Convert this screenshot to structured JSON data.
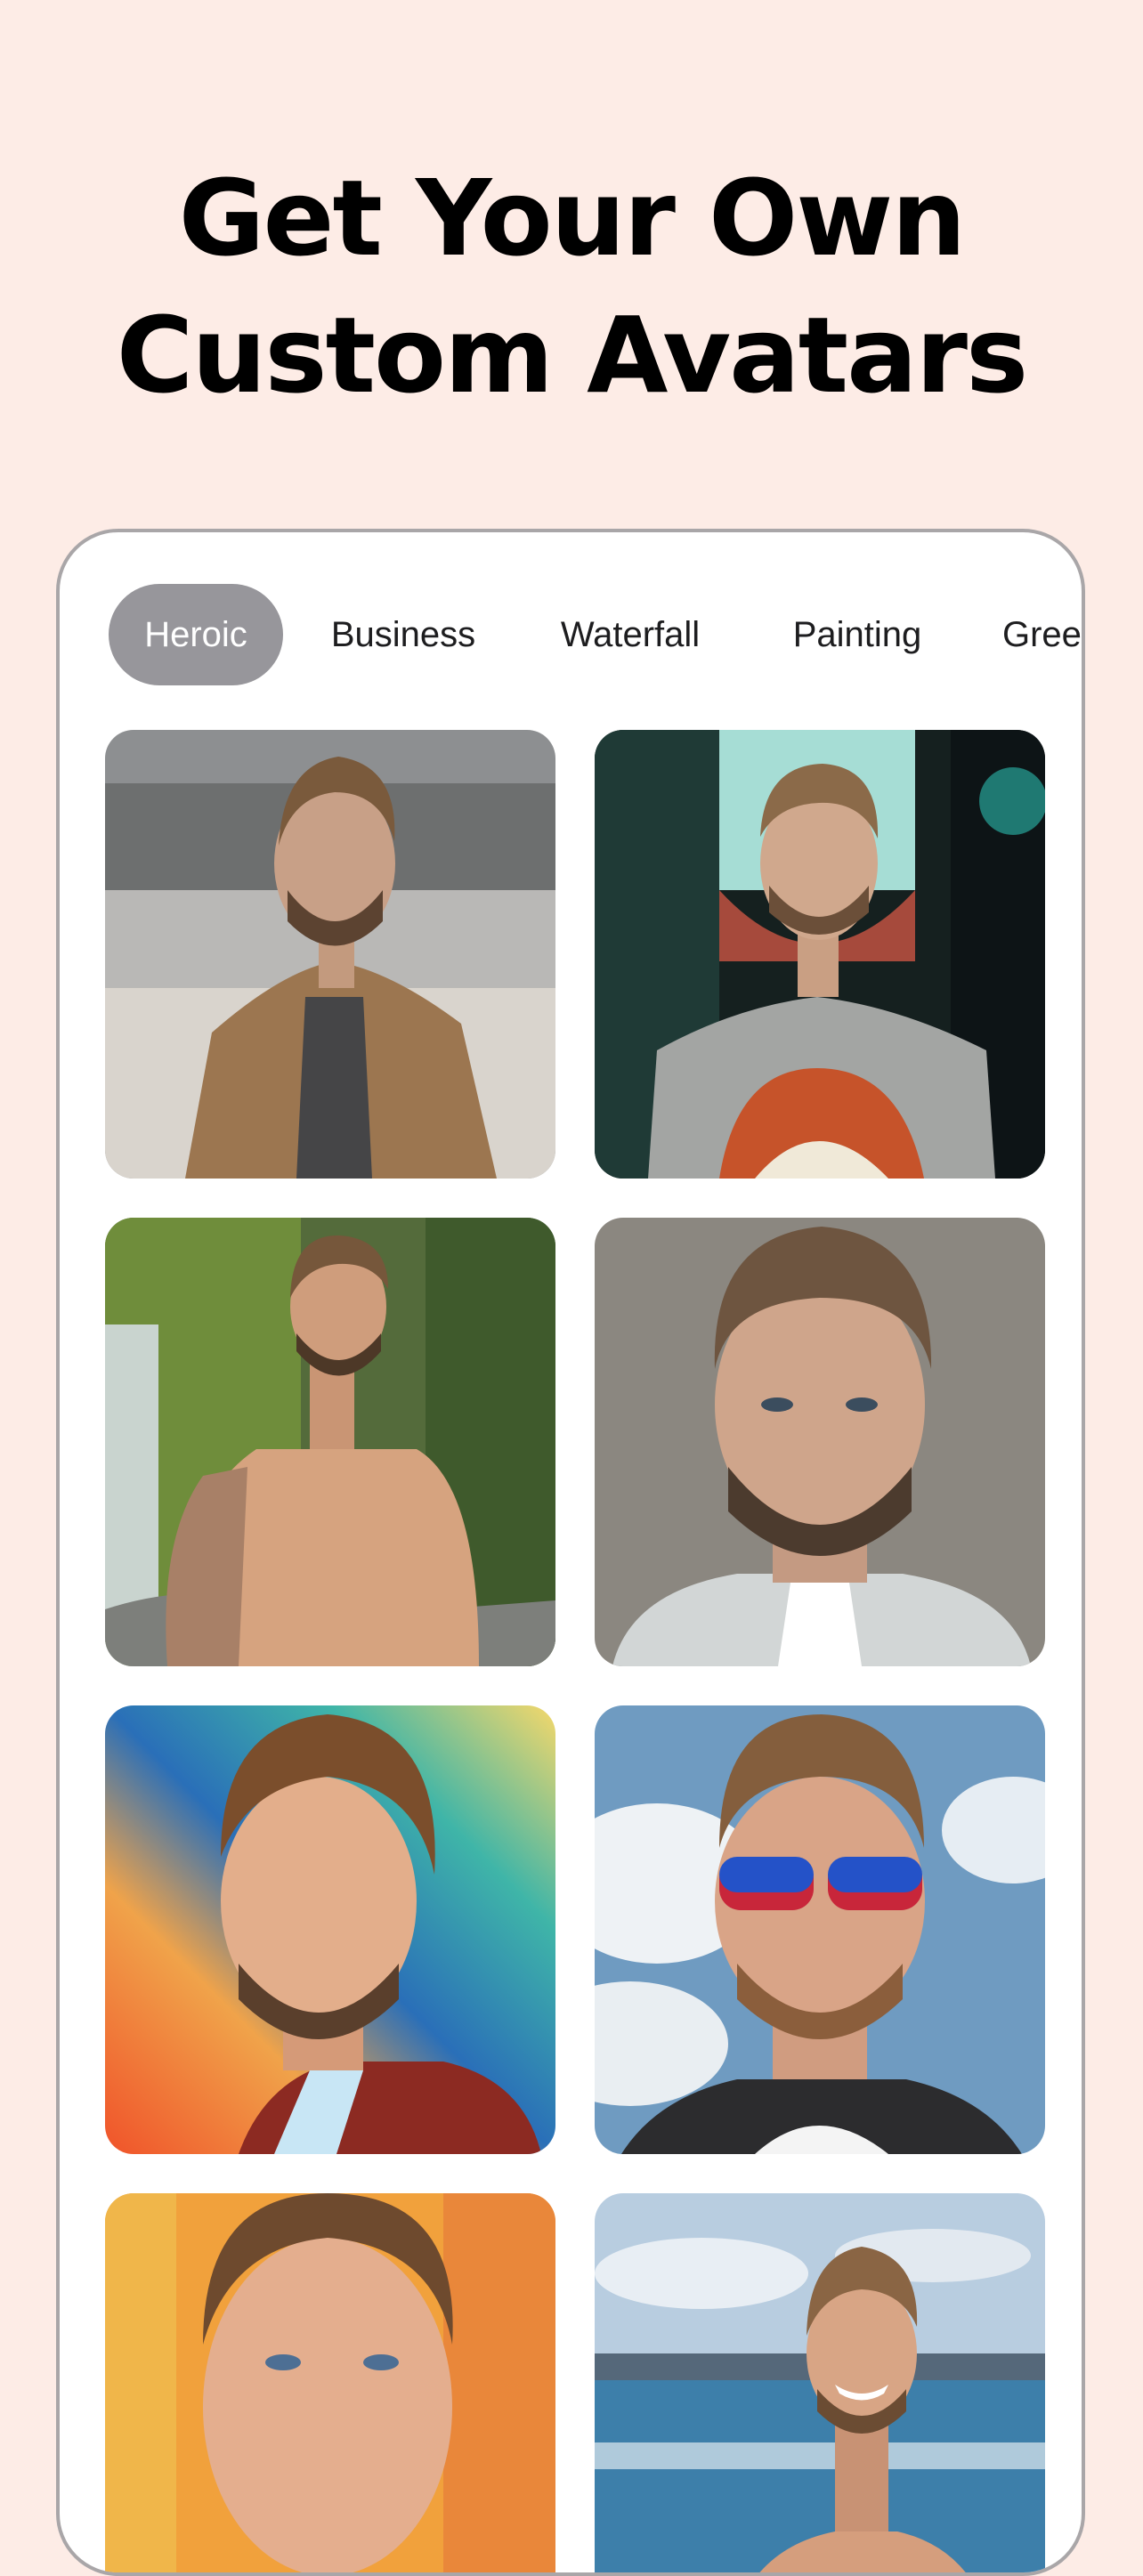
{
  "headline": {
    "line1": "Get Your Own",
    "line2": "Custom Avatars"
  },
  "tabs": [
    {
      "label": "Heroic",
      "active": true
    },
    {
      "label": "Business",
      "active": false
    },
    {
      "label": "Waterfall",
      "active": false
    },
    {
      "label": "Painting",
      "active": false
    },
    {
      "label": "Gree",
      "active": false
    }
  ],
  "avatars": [
    {
      "style": "painted-brown-jacket"
    },
    {
      "style": "armored-hero"
    },
    {
      "style": "waterfall-shirtless"
    },
    {
      "style": "portrait-painting"
    },
    {
      "style": "colorful-gradient"
    },
    {
      "style": "sunglasses-sky"
    },
    {
      "style": "warm-portrait"
    },
    {
      "style": "beach-smile"
    }
  ],
  "colors": {
    "background": "#fdece6",
    "card": "#ffffff",
    "active_tab": "#97969b"
  }
}
